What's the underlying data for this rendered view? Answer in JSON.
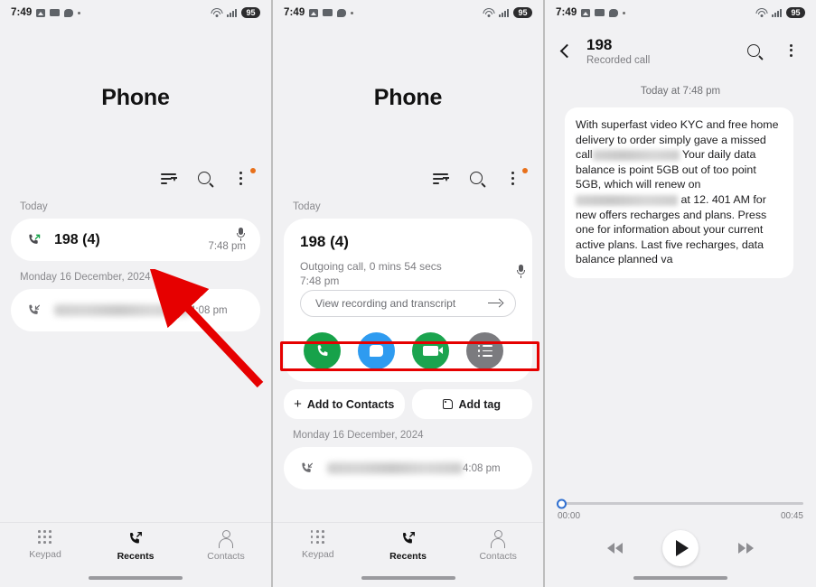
{
  "statusbar": {
    "time": "7:49",
    "battery": "95",
    "icons": [
      "photos-icon",
      "card-icon",
      "chat-icon",
      "dot-icon",
      "wifi-icon",
      "signal-icon",
      "battery-badge"
    ]
  },
  "panel1": {
    "app_title": "Phone",
    "toolbar": {
      "sort_icon": "sort-icon",
      "search_icon": "search-icon",
      "menu_icon": "kebab-menu-icon",
      "badge": true
    },
    "sections": [
      {
        "label": "Today",
        "rows": [
          {
            "name": "198 (4)",
            "time": "7:48 pm",
            "direction": "outgoing",
            "recorded": true
          }
        ]
      },
      {
        "label": "Monday 16 December, 2024",
        "rows": [
          {
            "name": "",
            "time": "4:08 pm",
            "direction": "incoming",
            "blurred": true
          }
        ]
      }
    ],
    "nav": [
      {
        "label": "Keypad",
        "icon": "keypad-icon",
        "active": false
      },
      {
        "label": "Recents",
        "icon": "recents-icon",
        "active": true
      },
      {
        "label": "Contacts",
        "icon": "contacts-icon",
        "active": false
      }
    ]
  },
  "panel2": {
    "app_title": "Phone",
    "sections": [
      {
        "label": "Today"
      },
      {
        "label": "Monday 16 December, 2024"
      }
    ],
    "detail": {
      "number": "198 (4)",
      "meta": "Outgoing call, 0 mins 54 secs",
      "meta_time": "7:48 pm",
      "view_recording_label": "View recording and transcript",
      "actions": [
        {
          "name": "call",
          "icon": "phone-icon",
          "color": "#17a24a"
        },
        {
          "name": "message",
          "icon": "message-icon",
          "color": "#2e9bf0"
        },
        {
          "name": "video-call",
          "icon": "video-icon",
          "color": "#1ba44f"
        },
        {
          "name": "details",
          "icon": "list-icon",
          "color": "#7b7b7f"
        }
      ],
      "add_contacts_label": "Add to Contacts",
      "add_tag_label": "Add tag"
    },
    "older_row": {
      "time": "4:08 pm",
      "blurred": true
    },
    "nav": [
      {
        "label": "Keypad",
        "icon": "keypad-icon",
        "active": false
      },
      {
        "label": "Recents",
        "icon": "recents-icon",
        "active": true
      },
      {
        "label": "Contacts",
        "icon": "contacts-icon",
        "active": false
      }
    ]
  },
  "panel3": {
    "title": "198",
    "subtitle": "Recorded call",
    "date_divider": "Today at 7:48 pm",
    "transcript": {
      "part1": "With superfast video KYC and free home delivery to order simply gave a missed call",
      "part2": "Your daily data balance is point 5GB out of too point 5GB, which will renew on",
      "part3": "at 12. 401 AM for new offers recharges and plans. Press one for information about your current active plans. Last five recharges, data balance planned va"
    },
    "player": {
      "current_time": "00:00",
      "total_time": "00:45",
      "rewind_icon": "rewind-icon",
      "play_icon": "play-icon",
      "forward_icon": "fast-forward-icon",
      "progress_percent": 0
    },
    "search_icon": "search-icon",
    "menu_icon": "kebab-menu-icon",
    "back_icon": "back-chevron-icon"
  },
  "annotations": {
    "highlight_color": "#e60000",
    "arrow_color": "#e60000"
  }
}
